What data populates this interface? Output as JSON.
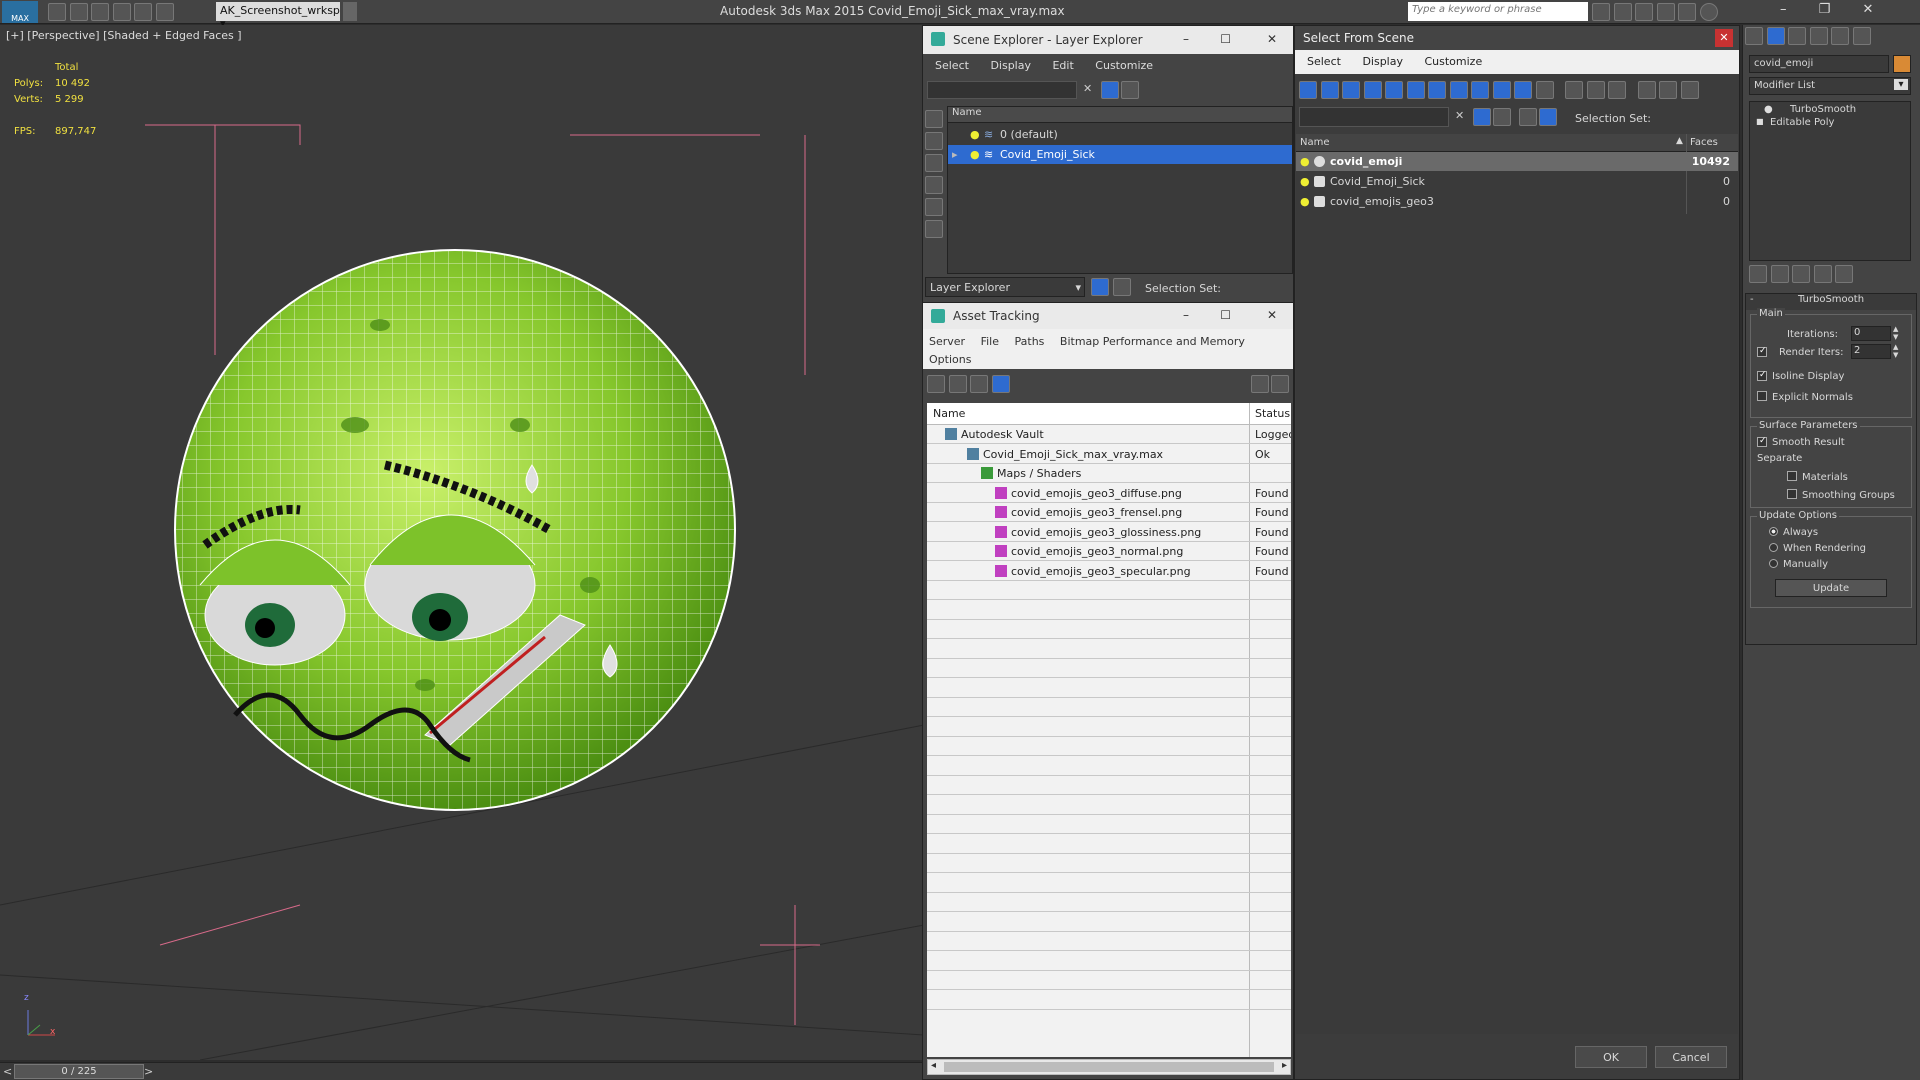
{
  "app": {
    "title": "Autodesk 3ds Max  2015     Covid_Emoji_Sick_max_vray.max",
    "logo": "MAX",
    "workspace": "AK_Screenshot_wrksp",
    "search_placeholder": "Type a keyword or phrase"
  },
  "viewport": {
    "label": "[+] [Perspective] [Shaded + Edged Faces ]",
    "stats": {
      "total_label": "Total",
      "polys_label": "Polys:",
      "polys": "10 492",
      "verts_label": "Verts:",
      "verts": "5 299",
      "fps_label": "FPS:",
      "fps": "897,747"
    },
    "timeline": "0 / 225",
    "prev": "<",
    "next": ">",
    "axis_z": "z",
    "axis_x": "x"
  },
  "scene_explorer": {
    "title": "Scene Explorer - Layer Explorer",
    "menu": [
      "Select",
      "Display",
      "Edit",
      "Customize"
    ],
    "column": "Name",
    "rows": [
      "0 (default)",
      "Covid_Emoji_Sick"
    ],
    "footer_dropdown": "Layer Explorer",
    "selection_set_label": "Selection Set:"
  },
  "asset_tracking": {
    "title": "Asset Tracking",
    "menu": [
      "Server",
      "File",
      "Paths",
      "Bitmap Performance and Memory"
    ],
    "menu2": "Options",
    "col_name": "Name",
    "col_status": "Status",
    "rows": [
      {
        "name": "Autodesk Vault",
        "status": "Logged"
      },
      {
        "name": "Covid_Emoji_Sick_max_vray.max",
        "status": "Ok"
      },
      {
        "name": "Maps / Shaders",
        "status": ""
      },
      {
        "name": "covid_emojis_geo3_diffuse.png",
        "status": "Found"
      },
      {
        "name": "covid_emojis_geo3_frensel.png",
        "status": "Found"
      },
      {
        "name": "covid_emojis_geo3_glossiness.png",
        "status": "Found"
      },
      {
        "name": "covid_emojis_geo3_normal.png",
        "status": "Found"
      },
      {
        "name": "covid_emojis_geo3_specular.png",
        "status": "Found"
      }
    ]
  },
  "select_from_scene": {
    "title": "Select From Scene",
    "menu": [
      "Select",
      "Display",
      "Customize"
    ],
    "selection_set_label": "Selection Set:",
    "col_name": "Name",
    "col_faces": "Faces",
    "rows": [
      {
        "name": "covid_emoji",
        "faces": "10492"
      },
      {
        "name": "Covid_Emoji_Sick",
        "faces": "0"
      },
      {
        "name": "covid_emojis_geo3",
        "faces": "0"
      }
    ],
    "ok": "OK",
    "cancel": "Cancel"
  },
  "modifier_panel": {
    "object_name": "covid_emoji",
    "modifier_list": "Modifier List",
    "stack": [
      "TurboSmooth",
      "Editable Poly"
    ],
    "rollout_title": "TurboSmooth",
    "main_label": "Main",
    "iterations_label": "Iterations:",
    "iterations": "0",
    "render_iters_label": "Render Iters:",
    "render_iters": "2",
    "isoline": "Isoline Display",
    "explicit_normals": "Explicit Normals",
    "surface_params": "Surface Parameters",
    "smooth_result": "Smooth Result",
    "separate": "Separate",
    "materials": "Materials",
    "smoothing_groups": "Smoothing Groups",
    "update_options": "Update Options",
    "always": "Always",
    "when_rendering": "When Rendering",
    "manually": "Manually",
    "update_btn": "Update"
  },
  "colors": {
    "virus_green": "#7dc22a",
    "selection_blue": "#2e6bd0",
    "panel_grey": "#444444"
  }
}
